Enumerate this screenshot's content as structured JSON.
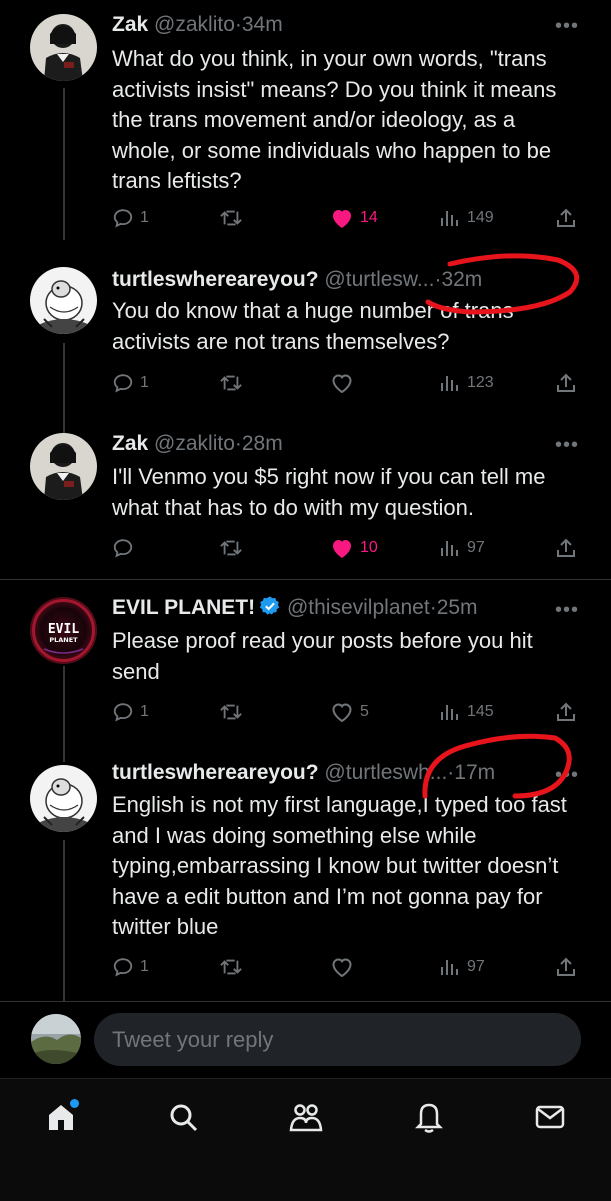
{
  "tweets": [
    {
      "name": "Zak",
      "handle": "@zaklito",
      "time": "34m",
      "text": "What do you think, in your own words, \"trans activists insist\" means? Do you think it means the trans movement and/or ideology, as a whole, or some individuals who happen to be trans leftists?",
      "replies": "1",
      "retweets": "",
      "likes": "14",
      "liked": true,
      "views": "149",
      "avatar_icon": "person-photo"
    },
    {
      "name": "turtleswhereareyou?",
      "handle": "@turtlesw...",
      "time": "32m",
      "text": "You do know that a huge number of trans activists are not trans themselves?",
      "replies": "1",
      "retweets": "",
      "likes": "",
      "liked": false,
      "views": "123",
      "avatar_icon": "turtle-drawing"
    },
    {
      "name": "Zak",
      "handle": "@zaklito",
      "time": "28m",
      "text": "I'll Venmo you $5 right now if you can tell me what that has to do with my question.",
      "replies": "",
      "retweets": "",
      "likes": "10",
      "liked": true,
      "views": "97",
      "avatar_icon": "person-photo"
    },
    {
      "name": "EVIL PLANET!",
      "handle": "@thisevilplanet",
      "time": "25m",
      "verified": true,
      "text": "Please proof read your posts before you hit send",
      "replies": "1",
      "retweets": "",
      "likes": "5",
      "liked": false,
      "views": "145",
      "avatar_icon": "evil-planet-logo",
      "avatar_text": "EVIL PLANET"
    },
    {
      "name": "turtleswhereareyou?",
      "handle": "@turtleswh...",
      "time": "17m",
      "text": "English is not my first language,I typed too fast and I was doing something else while typing,embarrassing I know but twitter doesn’t have a edit button and I’m not gonna pay for twitter blue",
      "replies": "1",
      "retweets": "",
      "likes": "",
      "liked": false,
      "views": "97",
      "avatar_icon": "turtle-drawing"
    }
  ],
  "dot_separator": "·",
  "more_label": "•••",
  "reply": {
    "placeholder": "Tweet your reply"
  },
  "nav": {
    "items": [
      "home-icon",
      "search-icon",
      "communities-icon",
      "notifications-icon",
      "messages-icon"
    ]
  },
  "colors": {
    "background": "#000000",
    "text": "#e7e9ea",
    "muted": "#71767b",
    "like": "#f91880",
    "verified": "#1d9bf0",
    "annotation": "#e8141b"
  }
}
